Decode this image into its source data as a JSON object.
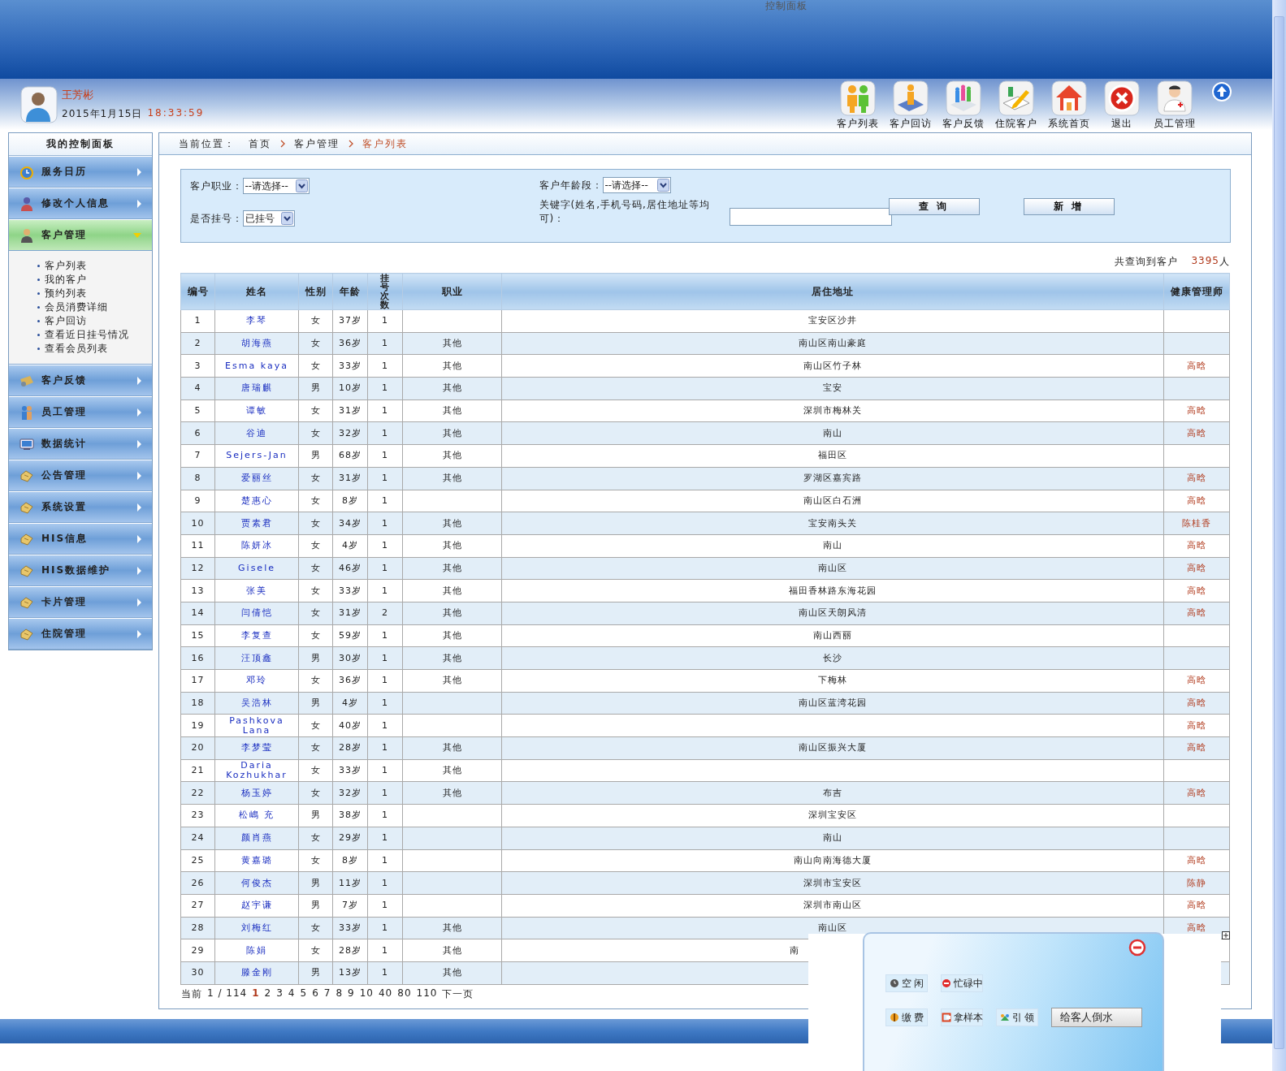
{
  "window": {
    "title": "控制面板"
  },
  "user": {
    "name": "王芳彬",
    "date": "2015年1月15日",
    "time": "18:33:59"
  },
  "toolbar": [
    {
      "label": "客户列表",
      "kind": "people"
    },
    {
      "label": "客户回访",
      "kind": "book"
    },
    {
      "label": "客户反馈",
      "kind": "group"
    },
    {
      "label": "住院客户",
      "kind": "pencil"
    },
    {
      "label": "系统首页",
      "kind": "house"
    },
    {
      "label": "退出",
      "kind": "close"
    },
    {
      "label": "员工管理",
      "kind": "doctor"
    }
  ],
  "sidebar": {
    "title": "我的控制面板",
    "items": [
      {
        "label": "服务日历",
        "kind": "clock",
        "expanded": false
      },
      {
        "label": "修改个人信息",
        "kind": "person",
        "expanded": false
      },
      {
        "label": "客户管理",
        "kind": "user",
        "expanded": true,
        "children": [
          {
            "label": "客户列表"
          },
          {
            "label": "我的客户"
          },
          {
            "label": "预约列表"
          },
          {
            "label": "会员消费详细"
          },
          {
            "label": "客户回访"
          },
          {
            "label": "查看近日挂号情况"
          },
          {
            "label": "查看会员列表"
          }
        ]
      },
      {
        "label": "客户反馈",
        "kind": "card",
        "expanded": false
      },
      {
        "label": "员工管理",
        "kind": "staff",
        "expanded": false
      },
      {
        "label": "数据统计",
        "kind": "monitor",
        "expanded": false
      },
      {
        "label": "公告管理",
        "kind": "hand",
        "expanded": false
      },
      {
        "label": "系统设置",
        "kind": "hand",
        "expanded": false
      },
      {
        "label": "HIS信息",
        "kind": "hand",
        "expanded": false
      },
      {
        "label": "HIS数据维护",
        "kind": "hand",
        "expanded": false
      },
      {
        "label": "卡片管理",
        "kind": "hand",
        "expanded": false
      },
      {
        "label": "住院管理",
        "kind": "hand",
        "expanded": false
      }
    ]
  },
  "breadcrumb": {
    "label": "当前位置：",
    "items": [
      {
        "label": "首页",
        "selected": false
      },
      {
        "label": "客户管理",
        "selected": false
      },
      {
        "label": "客户列表",
        "selected": true
      }
    ]
  },
  "filters": {
    "occupation": {
      "label": "客户职业：",
      "value": "--请选择--"
    },
    "registered": {
      "label": "是否挂号：",
      "value": "已挂号"
    },
    "age_group": {
      "label": "客户年龄段：",
      "value": "--请选择--"
    },
    "keyword": {
      "label": "关键字(姓名,手机号码,居住地址等均可)："
    },
    "buttons": [
      "查 询",
      "新 增"
    ]
  },
  "summary": {
    "label": "共查询到客户",
    "count": "3395",
    "unit": "人"
  },
  "table": {
    "columns": [
      "编号",
      "姓名",
      "性别",
      "年龄",
      "挂号次数",
      "职业",
      "居住地址",
      "健康管理师"
    ],
    "rows": [
      {
        "no": "1",
        "name": "李琴",
        "sex": "女",
        "age": "37岁",
        "visits": "1",
        "address": "宝安区沙井"
      },
      {
        "no": "2",
        "name": "胡海燕",
        "sex": "女",
        "age": "36岁",
        "visits": "1",
        "job": "其他",
        "address": "南山区南山豪庭"
      },
      {
        "no": "3",
        "name": "Esma kaya",
        "sex": "女",
        "age": "33岁",
        "visits": "1",
        "job": "其他",
        "address": "南山区竹子林",
        "manager": "高晗"
      },
      {
        "no": "4",
        "name": "唐瑞麒",
        "sex": "男",
        "age": "10岁",
        "visits": "1",
        "job": "其他",
        "address": "宝安"
      },
      {
        "no": "5",
        "name": "谭敏",
        "sex": "女",
        "age": "31岁",
        "visits": "1",
        "job": "其他",
        "address": "深圳市梅林关",
        "manager": "高晗"
      },
      {
        "no": "6",
        "name": "谷迪",
        "sex": "女",
        "age": "32岁",
        "visits": "1",
        "job": "其他",
        "address": "南山",
        "manager": "高晗"
      },
      {
        "no": "7",
        "name": "Sejers-Jan",
        "sex": "男",
        "age": "68岁",
        "visits": "1",
        "job": "其他",
        "address": "福田区"
      },
      {
        "no": "8",
        "name": "爱丽丝",
        "sex": "女",
        "age": "31岁",
        "visits": "1",
        "job": "其他",
        "address": "罗湖区嘉宾路",
        "manager": "高晗"
      },
      {
        "no": "9",
        "name": "楚惠心",
        "sex": "女",
        "age": "8岁",
        "visits": "1",
        "address": "南山区白石洲",
        "manager": "高晗"
      },
      {
        "no": "10",
        "name": "贾素君",
        "sex": "女",
        "age": "34岁",
        "visits": "1",
        "job": "其他",
        "address": "宝安南头关",
        "manager": "陈桂香"
      },
      {
        "no": "11",
        "name": "陈妍冰",
        "sex": "女",
        "age": "4岁",
        "visits": "1",
        "job": "其他",
        "address": "南山",
        "manager": "高晗"
      },
      {
        "no": "12",
        "name": "Gisele",
        "sex": "女",
        "age": "46岁",
        "visits": "1",
        "job": "其他",
        "address": "南山区",
        "manager": "高晗"
      },
      {
        "no": "13",
        "name": "张美",
        "sex": "女",
        "age": "33岁",
        "visits": "1",
        "job": "其他",
        "address": "福田香林路东海花园",
        "manager": "高晗"
      },
      {
        "no": "14",
        "name": "闫倩恺",
        "sex": "女",
        "age": "31岁",
        "visits": "2",
        "job": "其他",
        "address": "南山区天朗风清",
        "manager": "高晗"
      },
      {
        "no": "15",
        "name": "李复查",
        "sex": "女",
        "age": "59岁",
        "visits": "1",
        "job": "其他",
        "address": "南山西丽"
      },
      {
        "no": "16",
        "name": "汪顶鑫",
        "sex": "男",
        "age": "30岁",
        "visits": "1",
        "job": "其他",
        "address": "长沙"
      },
      {
        "no": "17",
        "name": "邓玲",
        "sex": "女",
        "age": "36岁",
        "visits": "1",
        "job": "其他",
        "address": "下梅林",
        "manager": "高晗"
      },
      {
        "no": "18",
        "name": "吴浩林",
        "sex": "男",
        "age": "4岁",
        "visits": "1",
        "address": "南山区蓝湾花园",
        "manager": "高晗"
      },
      {
        "no": "19",
        "name": "Pashkova Lana",
        "sex": "女",
        "age": "40岁",
        "visits": "1",
        "manager": "高晗"
      },
      {
        "no": "20",
        "name": "李梦莹",
        "sex": "女",
        "age": "28岁",
        "visits": "1",
        "job": "其他",
        "address": "南山区振兴大厦",
        "manager": "高晗"
      },
      {
        "no": "21",
        "name": "Daria Kozhukhar",
        "sex": "女",
        "age": "33岁",
        "visits": "1",
        "job": "其他"
      },
      {
        "no": "22",
        "name": "杨玉婷",
        "sex": "女",
        "age": "32岁",
        "visits": "1",
        "job": "其他",
        "address": "布吉",
        "manager": "高晗"
      },
      {
        "no": "23",
        "name": "松嶋 充",
        "sex": "男",
        "age": "38岁",
        "visits": "1",
        "address": "深圳宝安区"
      },
      {
        "no": "24",
        "name": "颜肖燕",
        "sex": "女",
        "age": "29岁",
        "visits": "1",
        "address": "南山"
      },
      {
        "no": "25",
        "name": "黄嘉璐",
        "sex": "女",
        "age": "8岁",
        "visits": "1",
        "address": "南山向南海德大厦",
        "manager": "高晗"
      },
      {
        "no": "26",
        "name": "何俊杰",
        "sex": "男",
        "age": "11岁",
        "visits": "1",
        "address": "深圳市宝安区",
        "manager": "陈静"
      },
      {
        "no": "27",
        "name": "赵宇谦",
        "sex": "男",
        "age": "7岁",
        "visits": "1",
        "address": "深圳市南山区",
        "manager": "高晗"
      },
      {
        "no": "28",
        "name": "刘梅红",
        "sex": "女",
        "age": "33岁",
        "visits": "1",
        "job": "其他",
        "address": "南山区",
        "manager": "高晗"
      },
      {
        "no": "29",
        "name": "陈娟",
        "sex": "女",
        "age": "28岁",
        "visits": "1",
        "job": "其他",
        "address": "南",
        "address_cut": true
      },
      {
        "no": "30",
        "name": "滕金刚",
        "sex": "男",
        "age": "13岁",
        "visits": "1",
        "job": "其他"
      }
    ]
  },
  "pagination": {
    "label": "当前",
    "position": "1 / 114",
    "pages": [
      {
        "label": "1",
        "selected": true
      },
      {
        "label": "2",
        "selected": false
      },
      {
        "label": "3",
        "selected": false
      },
      {
        "label": "4",
        "selected": false
      },
      {
        "label": "5",
        "selected": false
      },
      {
        "label": "6",
        "selected": false
      },
      {
        "label": "7",
        "selected": false
      },
      {
        "label": "8",
        "selected": false
      },
      {
        "label": "9",
        "selected": false
      },
      {
        "label": "10",
        "selected": false
      },
      {
        "label": "40",
        "selected": false
      },
      {
        "label": "80",
        "selected": false
      },
      {
        "label": "110",
        "selected": false
      }
    ],
    "next": "下一页"
  },
  "popup": {
    "status_buttons": [
      {
        "label": "空 闲",
        "kind": "clock"
      },
      {
        "label": "忙碌中",
        "kind": "stop"
      }
    ],
    "task_buttons": [
      {
        "label": "缴 费",
        "kind": "dollar"
      },
      {
        "label": "拿样本",
        "kind": "sample"
      },
      {
        "label": "引 领",
        "kind": "group"
      }
    ],
    "action": "给客人倒水"
  }
}
